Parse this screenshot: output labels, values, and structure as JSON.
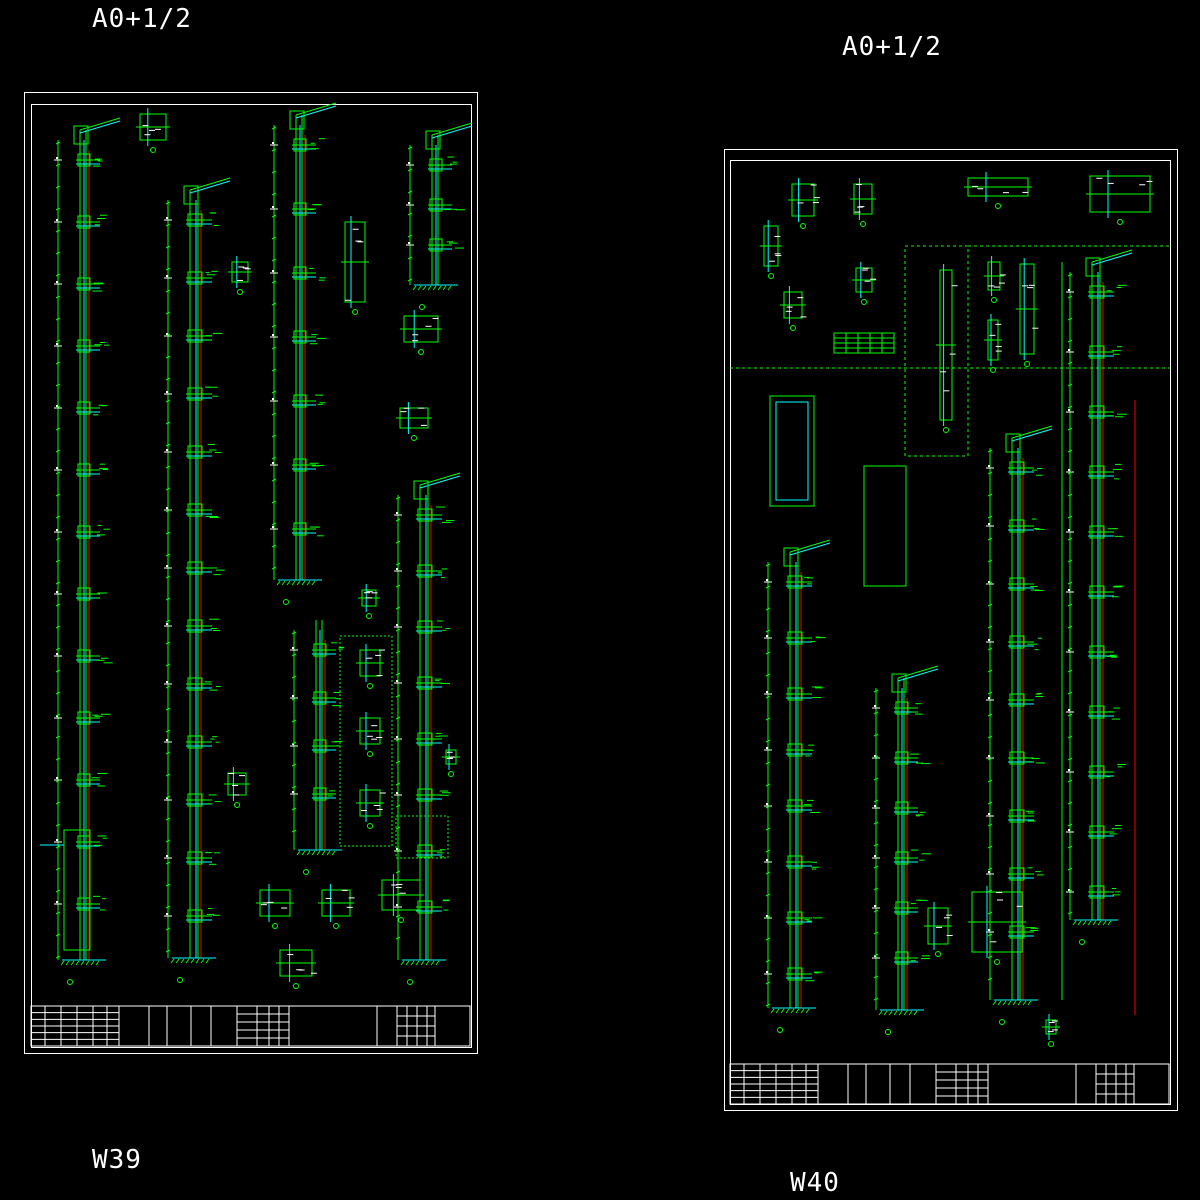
{
  "sheets": [
    {
      "id": "left",
      "size_label": "A0+1/2",
      "drawing_no": "W39"
    },
    {
      "id": "right",
      "size_label": "A0+1/2",
      "drawing_no": "W40"
    }
  ],
  "colors": {
    "background": "#000000",
    "frame": "#ffffff",
    "wall_line": "#00ff00",
    "accent_line": "#00ffff",
    "axis_line": "#ff0000",
    "text": "#ffffff"
  }
}
